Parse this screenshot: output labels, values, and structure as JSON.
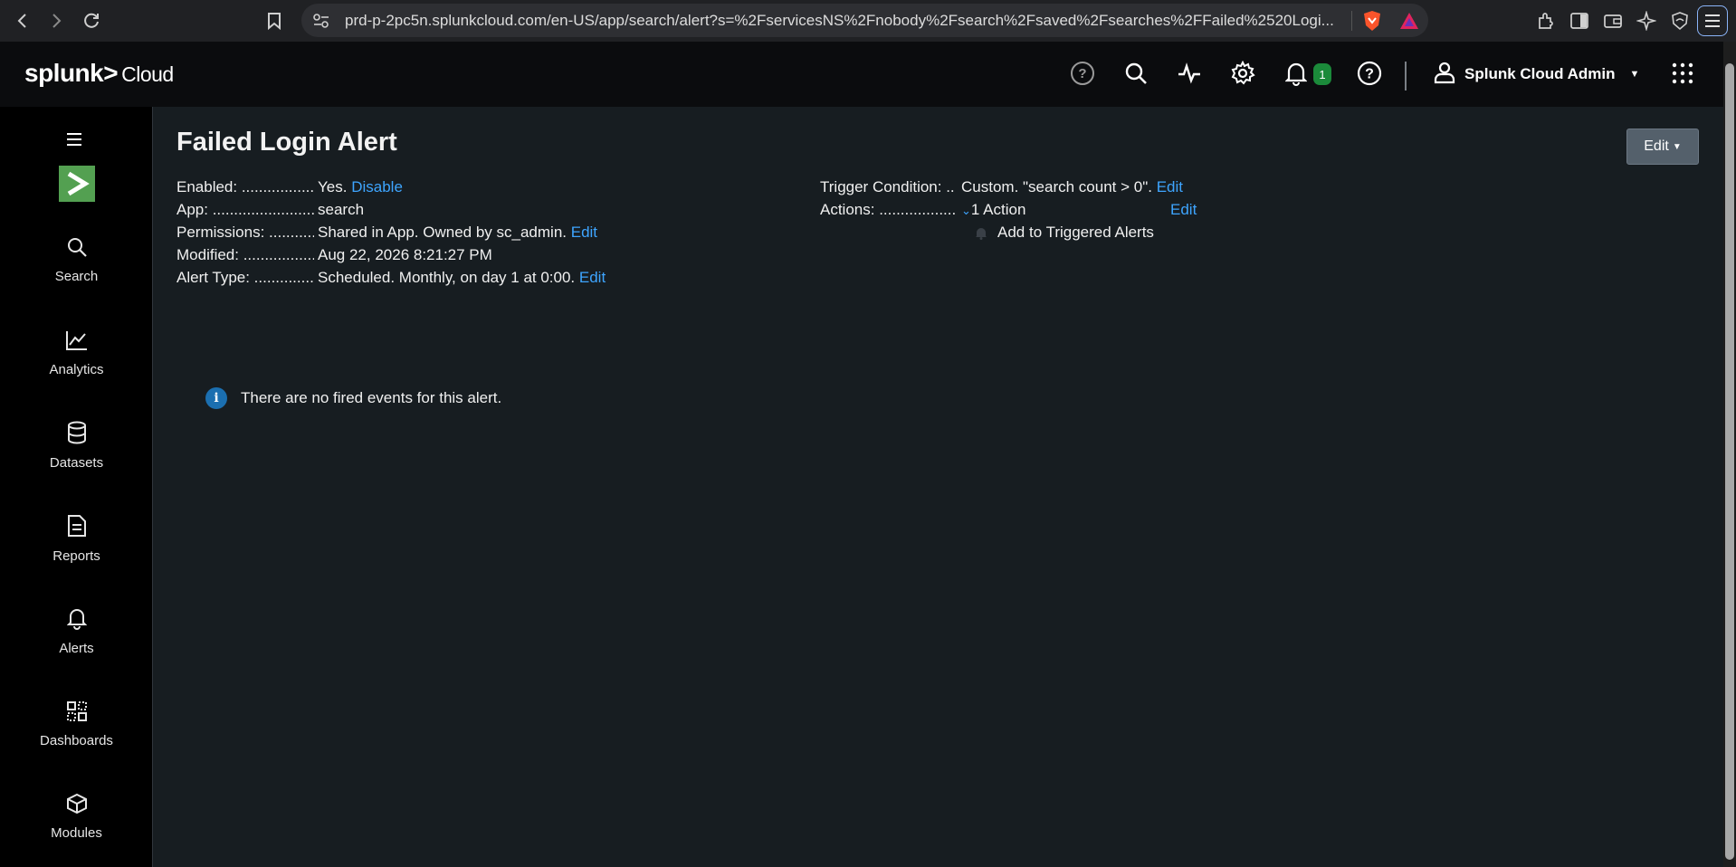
{
  "browser": {
    "url": "prd-p-2pc5n.splunkcloud.com/en-US/app/search/alert?s=%2FservicesNS%2Fnobody%2Fsearch%2Fsaved%2Fsearches%2FFailed%2520Logi..."
  },
  "header": {
    "logo_text": "splunk>",
    "logo_suffix": "Cloud",
    "notification_count": "1",
    "user_name": "Splunk Cloud Admin"
  },
  "sidebar": {
    "items": [
      {
        "label": "Search",
        "icon": "search-icon"
      },
      {
        "label": "Analytics",
        "icon": "analytics-icon"
      },
      {
        "label": "Datasets",
        "icon": "datasets-icon"
      },
      {
        "label": "Reports",
        "icon": "reports-icon"
      },
      {
        "label": "Alerts",
        "icon": "alerts-icon"
      },
      {
        "label": "Dashboards",
        "icon": "dashboards-icon"
      },
      {
        "label": "Modules",
        "icon": "modules-icon"
      }
    ]
  },
  "alert": {
    "title": "Failed Login Alert",
    "edit_button": "Edit",
    "enabled_label": "Enabled: ....................",
    "enabled_value": "Yes.",
    "enabled_link": "Disable",
    "app_label": "App: ............................",
    "app_value": "search",
    "permissions_label": "Permissions: ............",
    "permissions_value": "Shared in App. Owned by sc_admin.",
    "permissions_link": "Edit",
    "modified_label": "Modified: ...................",
    "modified_value": "Aug 22, 2026 8:21:27 PM",
    "alert_type_label": "Alert Type: ................",
    "alert_type_value": "Scheduled. Monthly, on day 1 at 0:00.",
    "alert_type_link": "Edit",
    "trigger_label": "Trigger Condition: ..",
    "trigger_value": "Custom. \"search count > 0\".",
    "trigger_link": "Edit",
    "actions_label": "Actions: .....................",
    "actions_value": "1 Action",
    "actions_link": "Edit",
    "action_item": "Add to Triggered Alerts"
  },
  "message": {
    "text": "There are no fired events for this alert."
  },
  "colors": {
    "accent_link": "#3ea5ff",
    "app_icon_green": "#53a051",
    "badge_green": "#1b8a3a"
  }
}
